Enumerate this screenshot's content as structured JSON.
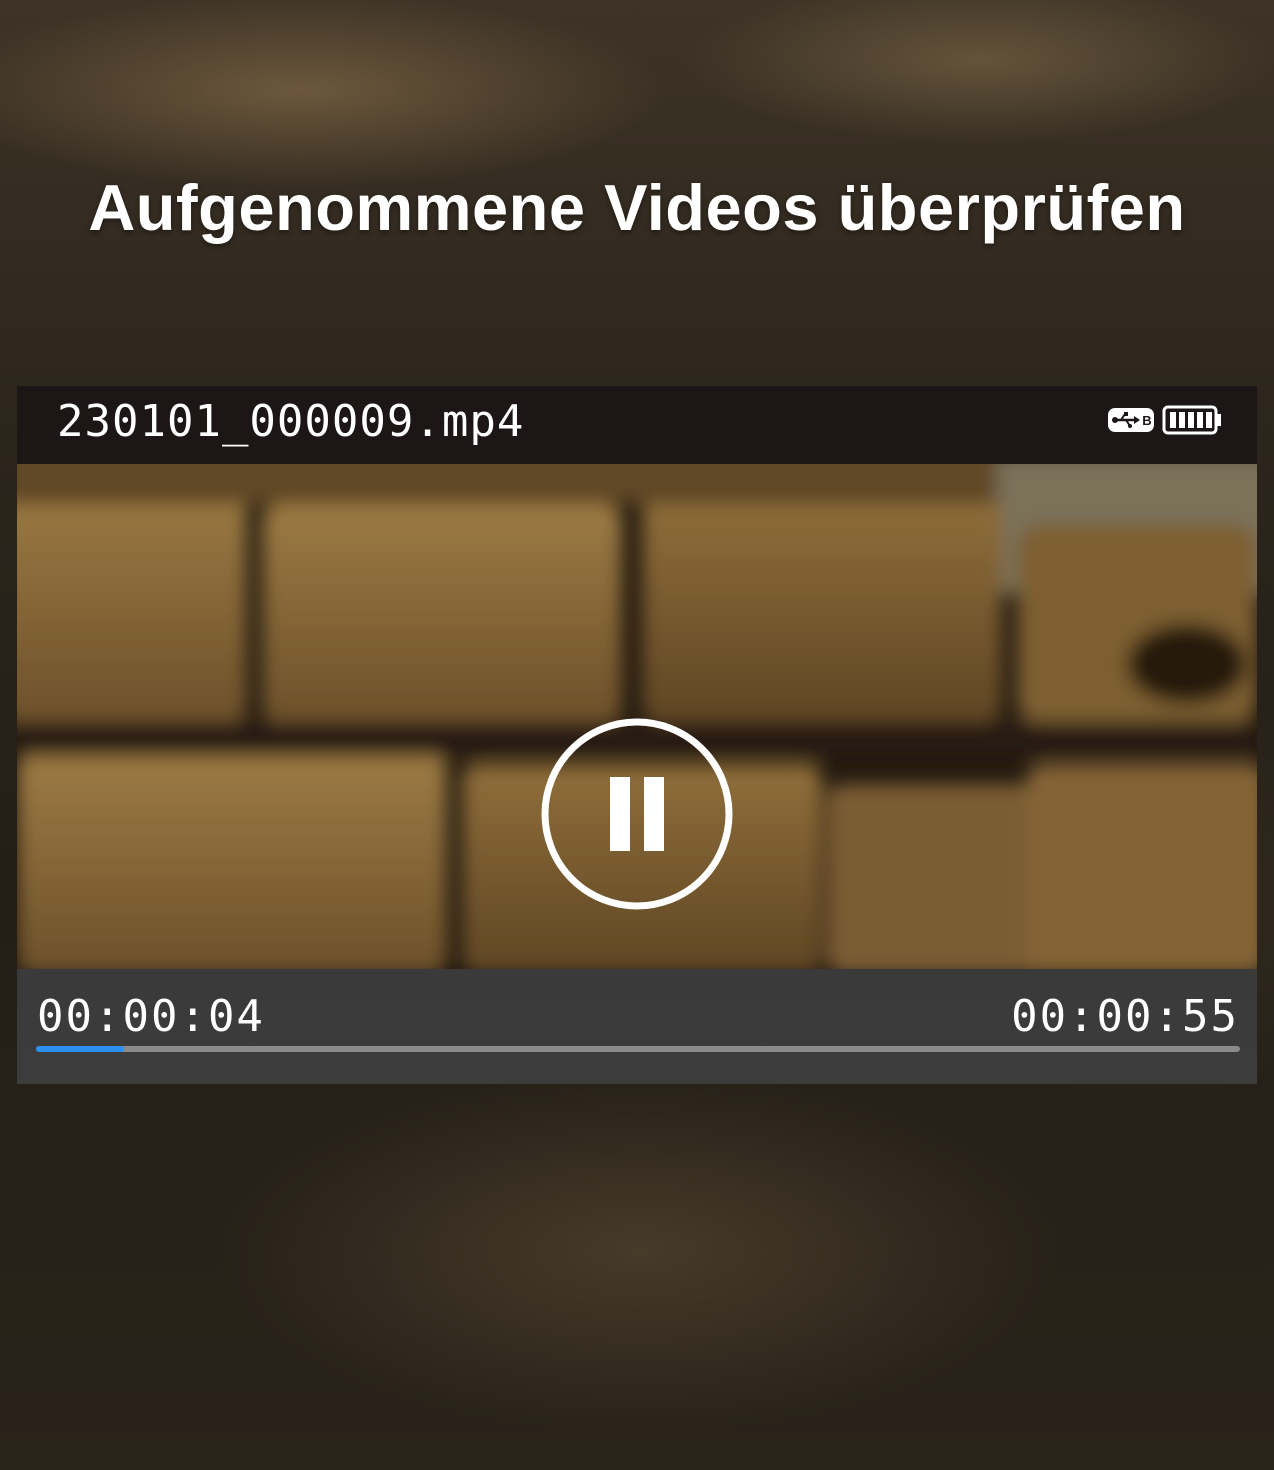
{
  "headline": "Aufgenommene Videos überprüfen",
  "player": {
    "filename": "230101_000009.mp4",
    "status_icons": [
      "usb-icon",
      "battery-full-icon"
    ],
    "usb_label": "B",
    "state": "playing",
    "control_icon": "pause-icon",
    "current_time": "00:00:04",
    "duration": "00:00:55",
    "progress_fraction": 0.073,
    "progress_color": "#2a8ff0"
  }
}
